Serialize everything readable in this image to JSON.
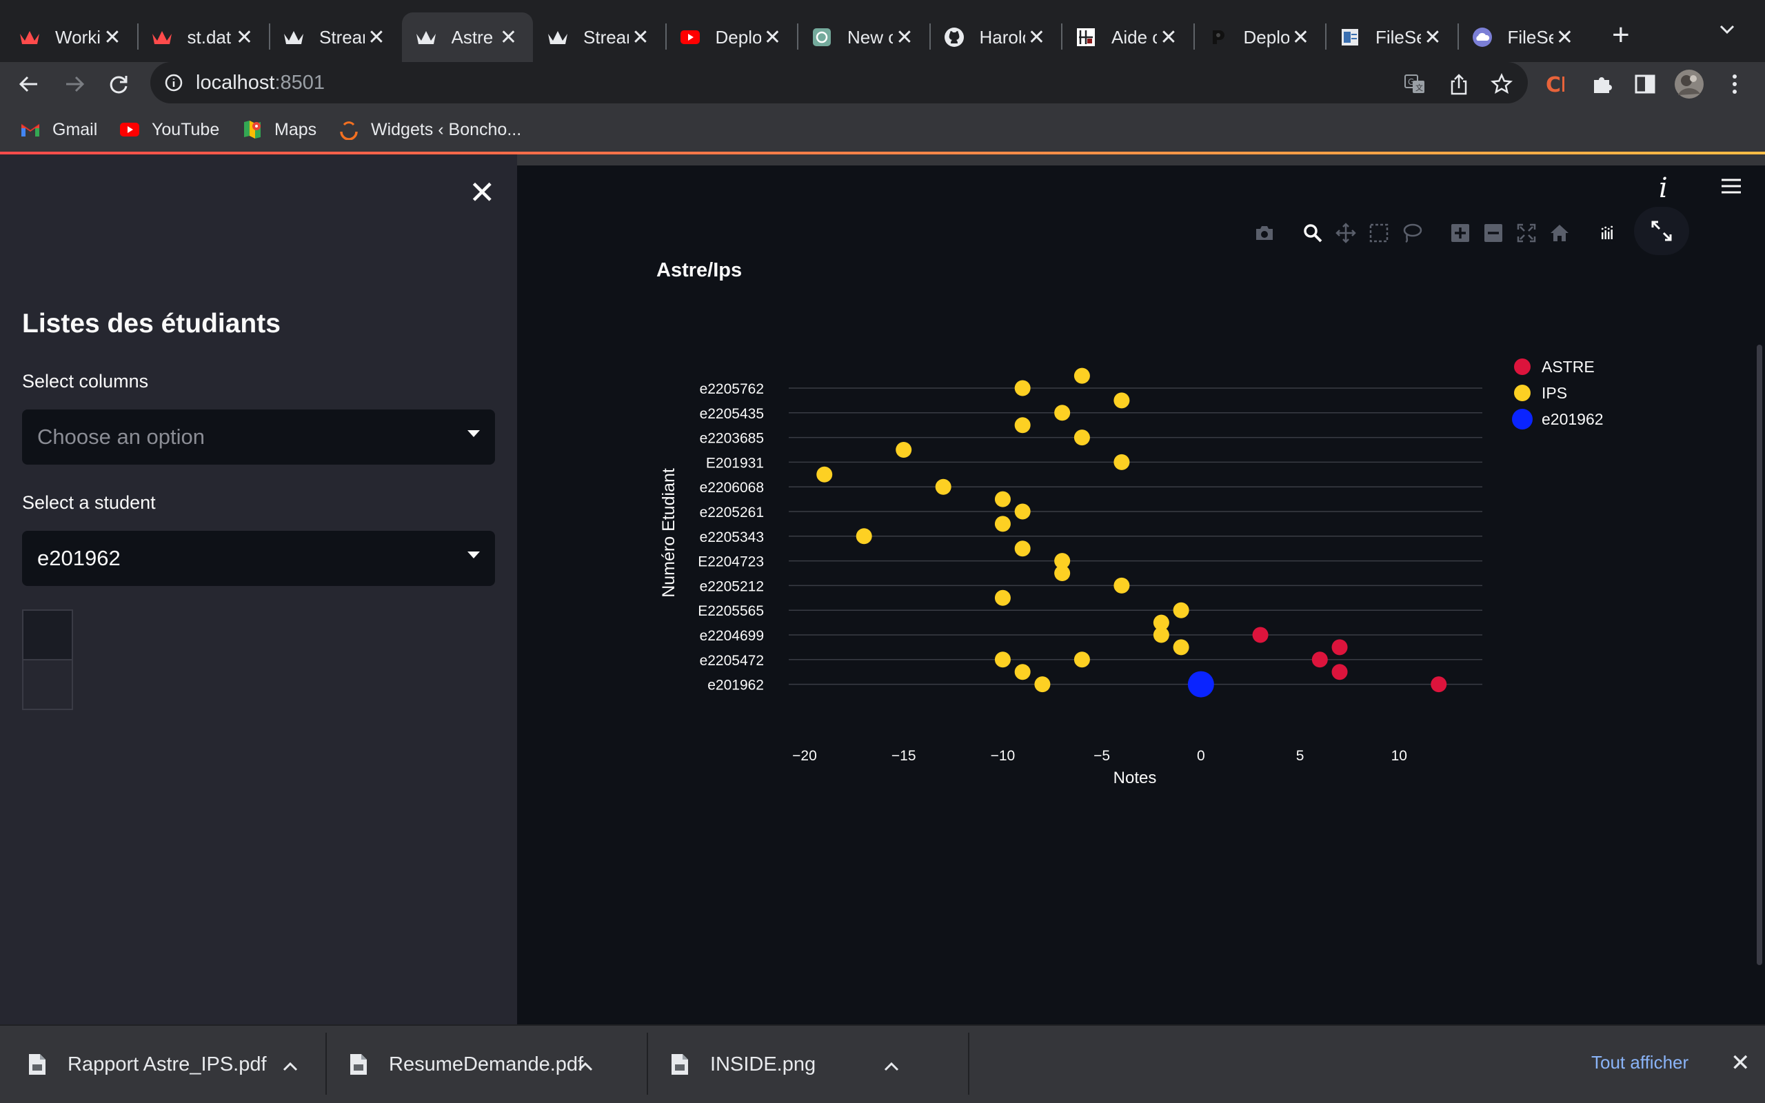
{
  "browser": {
    "tabs": [
      {
        "label": "Worki",
        "icon": "streamlit-crown-icon"
      },
      {
        "label": "st.dat",
        "icon": "streamlit-crown-icon"
      },
      {
        "label": "Strear",
        "icon": "streamlit-crown-white-icon"
      },
      {
        "label": "Astre",
        "icon": "streamlit-crown-white-icon",
        "active": true
      },
      {
        "label": "Strear",
        "icon": "streamlit-crown-white-icon"
      },
      {
        "label": "Deplo",
        "icon": "youtube-icon"
      },
      {
        "label": "New c",
        "icon": "chatgpt-icon"
      },
      {
        "label": "Harolc",
        "icon": "github-icon"
      },
      {
        "label": "Aide c",
        "icon": "aide-icon"
      },
      {
        "label": "Deplo",
        "icon": "render-icon"
      },
      {
        "label": "FileSe",
        "icon": "filesend-icon"
      },
      {
        "label": "FileSe",
        "icon": "cloud-icon"
      }
    ],
    "url_host": "localhost",
    "url_port": ":8501",
    "bookmarks": [
      {
        "label": "Gmail",
        "icon": "gmail-icon"
      },
      {
        "label": "YouTube",
        "icon": "youtube-icon"
      },
      {
        "label": "Maps",
        "icon": "maps-icon"
      },
      {
        "label": "Widgets ‹ Boncho...",
        "icon": "widgets-icon"
      }
    ],
    "colors": {
      "tabbar": "#202124",
      "toolbar": "#35363a",
      "link": "#8ab4f8"
    }
  },
  "sidebar": {
    "title": "Listes des étudiants",
    "select_columns_label": "Select columns",
    "select_columns_placeholder": "Choose an option",
    "select_student_label": "Select a student",
    "select_student_value": "e201962"
  },
  "main": {
    "chart_title": "Astre/Ips"
  },
  "chart_data": {
    "type": "scatter",
    "title": "Astre/Ips",
    "xlabel": "Notes",
    "ylabel": "Numéro Etudiant",
    "xlim": [
      -20.8,
      14.2
    ],
    "x_ticks": [
      -20,
      -15,
      -10,
      -5,
      0,
      5,
      10
    ],
    "x_tick_labels": [
      "−20",
      "−15",
      "−10",
      "−5",
      "0",
      "5",
      "10"
    ],
    "categories": [
      "e2205762",
      "e2205435",
      "e2203685",
      "E201931",
      "e2206068",
      "e2205261",
      "e2205343",
      "E2204723",
      "e2205212",
      "E2205565",
      "e2204699",
      "e2205472",
      "e201962"
    ],
    "grid": true,
    "legend_position": "top-right",
    "series": [
      {
        "name": "ASTRE",
        "color": "#dc143c",
        "points": [
          {
            "x": 3,
            "y": 10.0
          },
          {
            "x": 7,
            "y": 10.5
          },
          {
            "x": 6,
            "y": 11.0
          },
          {
            "x": 7,
            "y": 11.5
          },
          {
            "x": 12,
            "y": 12.0
          }
        ]
      },
      {
        "name": "IPS",
        "color": "#fdd023",
        "points": [
          {
            "x": -6,
            "y": -0.5
          },
          {
            "x": -9,
            "y": 0.0
          },
          {
            "x": -4,
            "y": 0.5
          },
          {
            "x": -7,
            "y": 1.0
          },
          {
            "x": -9,
            "y": 1.5
          },
          {
            "x": -6,
            "y": 2.0
          },
          {
            "x": -15,
            "y": 2.5
          },
          {
            "x": -4,
            "y": 3.0
          },
          {
            "x": -19,
            "y": 3.5
          },
          {
            "x": -13,
            "y": 4.0
          },
          {
            "x": -10,
            "y": 4.5
          },
          {
            "x": -9,
            "y": 5.0
          },
          {
            "x": -10,
            "y": 5.5
          },
          {
            "x": -17,
            "y": 6.0
          },
          {
            "x": -9,
            "y": 6.5
          },
          {
            "x": -7,
            "y": 7.0
          },
          {
            "x": -7,
            "y": 7.5
          },
          {
            "x": -4,
            "y": 8.0
          },
          {
            "x": -10,
            "y": 8.5
          },
          {
            "x": -1,
            "y": 9.0
          },
          {
            "x": -2,
            "y": 9.5
          },
          {
            "x": -2,
            "y": 10.0
          },
          {
            "x": -1,
            "y": 10.5
          },
          {
            "x": -10,
            "y": 11.0
          },
          {
            "x": -6,
            "y": 11.0
          },
          {
            "x": -9,
            "y": 11.5
          },
          {
            "x": -8,
            "y": 12.0
          }
        ]
      },
      {
        "name": "e201962",
        "color": "#0a24ff",
        "points": [
          {
            "x": 0,
            "y": 12.0
          }
        ]
      }
    ]
  },
  "downloads": {
    "items": [
      "Rapport Astre_IPS.pdf",
      "ResumeDemande.pdf",
      "INSIDE.png"
    ],
    "show_all": "Tout afficher"
  }
}
